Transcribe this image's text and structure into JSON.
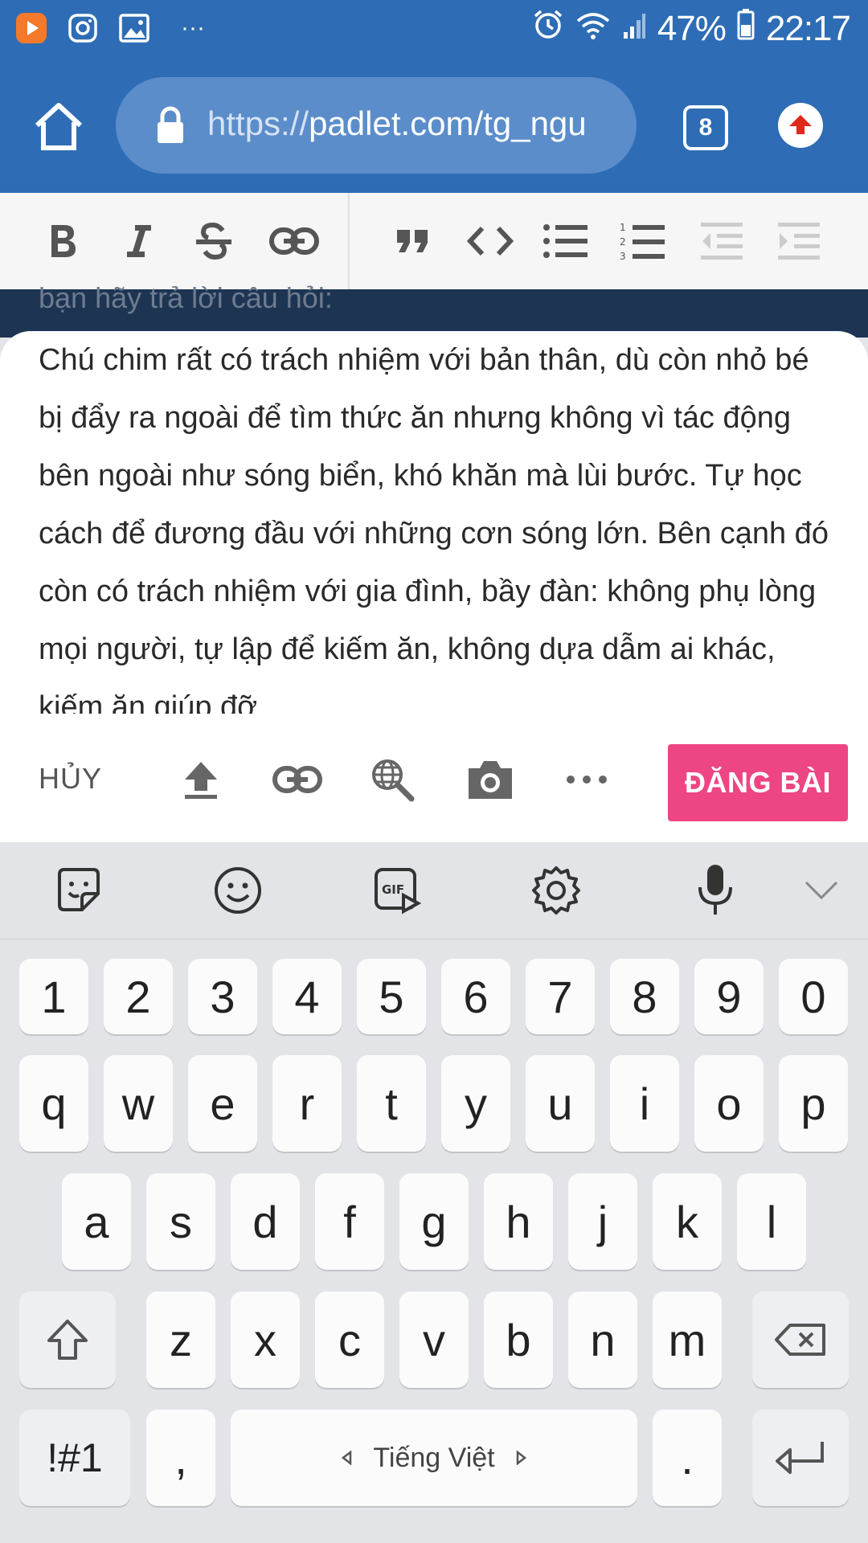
{
  "status_bar": {
    "battery_percent": "47%",
    "time": "22:17",
    "icons": [
      "video-app-icon",
      "instagram-icon",
      "gallery-icon",
      "more-notifications-icon",
      "alarm-icon",
      "wifi-icon",
      "signal-icon",
      "battery-icon"
    ],
    "more": "···"
  },
  "browser": {
    "url_scheme": "https://",
    "url_rest": "padlet.com/tg_ngu",
    "tab_count": "8",
    "accent": "#2e6db5"
  },
  "toolbar": {
    "buttons": [
      "bold",
      "italic",
      "strikethrough",
      "link",
      "quote",
      "code",
      "bullet-list",
      "numbered-list",
      "outdent",
      "indent"
    ]
  },
  "post": {
    "behind_text": "bạn hãy trả lời câu hỏi:",
    "body": "Chú chim rất có trách nhiệm với bản thân, dù còn nhỏ bé bị đẩy ra ngoài để tìm thức ăn nhưng không vì tác động bên ngoài như sóng biển, khó khăn mà lùi bước. Tự học cách để đương đầu với những cơn sóng lớn. Bên cạnh đó còn có trách nhiệm với gia đình, bầy đàn: không phụ lòng mọi người, tự lập để kiếm ăn, không dựa dẫm ai khác, kiếm ăn giúp đỡ",
    "cancel_label": "HỦY",
    "post_label": "ĐĂNG BÀI",
    "post_color": "#ee4584"
  },
  "keyboard": {
    "row_numbers": [
      "1",
      "2",
      "3",
      "4",
      "5",
      "6",
      "7",
      "8",
      "9",
      "0"
    ],
    "row1": [
      "q",
      "w",
      "e",
      "r",
      "t",
      "y",
      "u",
      "i",
      "o",
      "p"
    ],
    "row2": [
      "a",
      "s",
      "d",
      "f",
      "g",
      "h",
      "j",
      "k",
      "l"
    ],
    "row3": [
      "z",
      "x",
      "c",
      "v",
      "b",
      "n",
      "m"
    ],
    "symbols_label": "!#1",
    "comma": ",",
    "period": ".",
    "language": "Tiếng Việt",
    "gif_label": "GIF"
  }
}
